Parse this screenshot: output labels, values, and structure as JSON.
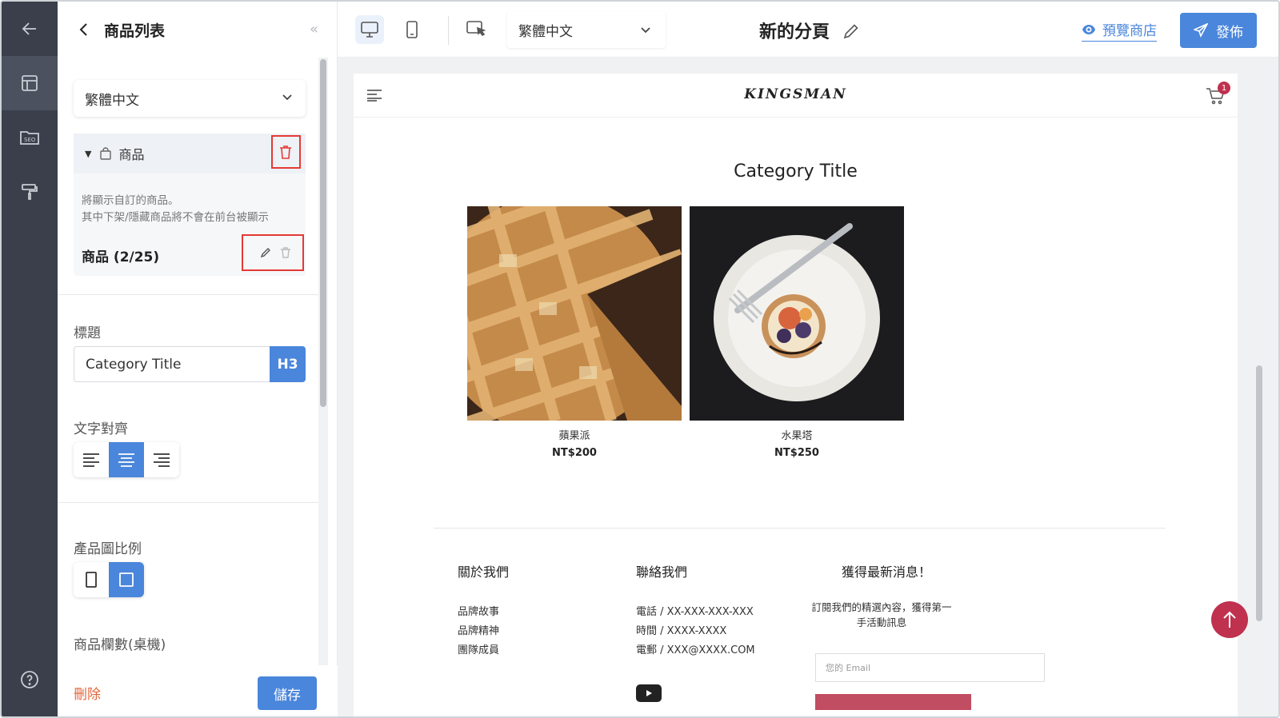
{
  "panel": {
    "title": "商品列表",
    "language": "繁體中文",
    "product_block": {
      "label": "商品",
      "description_line1": "將顯示自訂的商品。",
      "description_line2": "其中下架/隱藏商品將不會在前台被顯示",
      "count_label": "商品 (2/25)"
    },
    "title_field": {
      "label": "標題",
      "value": "Category Title",
      "heading_level": "H3"
    },
    "align_label": "文字對齊",
    "align_selected": "center",
    "ratio_label": "產品圖比例",
    "ratio_selected": "square",
    "columns_label": "商品欄數(桌機)",
    "delete_label": "刪除",
    "save_label": "儲存"
  },
  "topbar": {
    "language": "繁體中文",
    "page_title": "新的分頁",
    "preview_label": "預覽商店",
    "publish_label": "發佈"
  },
  "site": {
    "brand": "KINGSMAN",
    "cart_count": "1",
    "category_title": "Category Title",
    "products": [
      {
        "name": "蘋果派",
        "price": "NT$200"
      },
      {
        "name": "水果塔",
        "price": "NT$250"
      }
    ],
    "footer": {
      "about_title": "關於我們",
      "about_items": [
        "品牌故事",
        "品牌精神",
        "團隊成員"
      ],
      "contact_title": "聯絡我們",
      "contact_items": [
        "電話 / XX-XXX-XXX-XXX",
        "時間 / XXXX-XXXX",
        "電郵 / XXX@XXXX.COM"
      ],
      "news_title": "獲得最新消息！",
      "news_desc_line1": "訂閱我們的精選內容，獲得第一",
      "news_desc_line2": "手活動訊息",
      "email_placeholder": "您的 Email"
    }
  },
  "colors": {
    "accent": "#4a86db",
    "rail": "#3a3f4b",
    "brand_red": "#c0304f",
    "danger": "#e53935"
  }
}
